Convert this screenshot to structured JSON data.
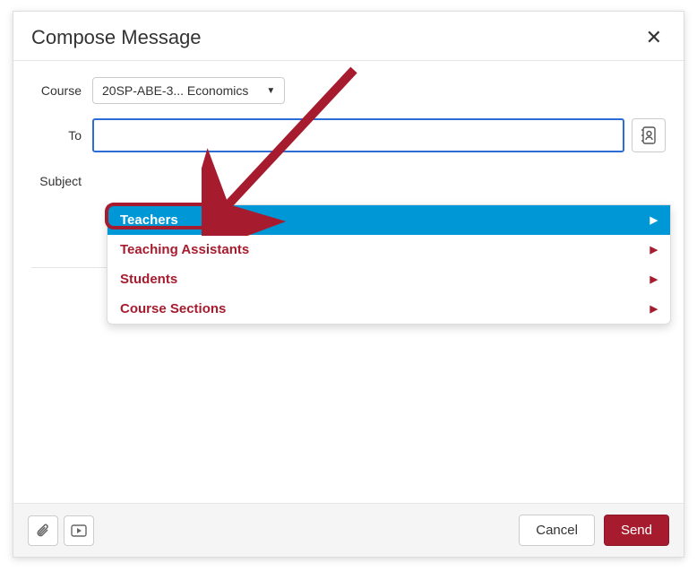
{
  "header": {
    "title": "Compose Message"
  },
  "form": {
    "course_label": "Course",
    "course_value": "20SP-ABE-3... Economics",
    "to_label": "To",
    "subject_label": "Subject"
  },
  "dropdown": {
    "items": [
      {
        "label": "Teachers",
        "active": true
      },
      {
        "label": "Teaching Assistants",
        "active": false
      },
      {
        "label": "Students",
        "active": false
      },
      {
        "label": "Course Sections",
        "active": false
      }
    ]
  },
  "footer": {
    "cancel": "Cancel",
    "send": "Send"
  }
}
